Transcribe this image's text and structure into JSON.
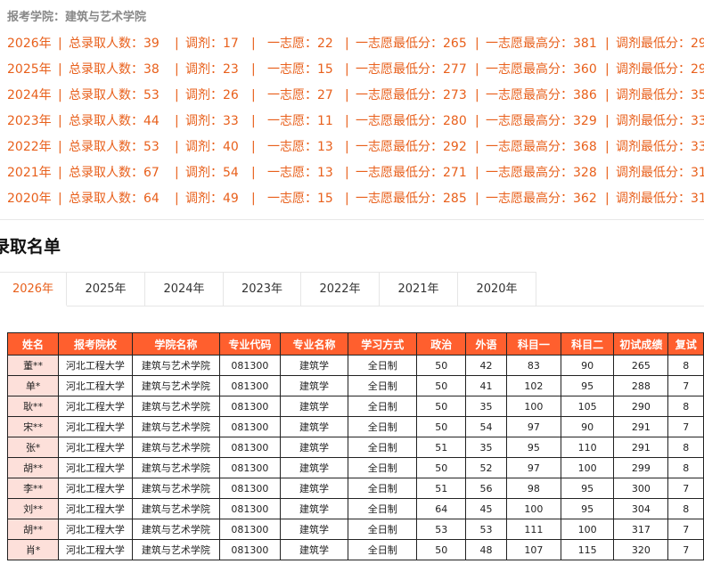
{
  "college_line": "报考学院：建筑与艺术学院",
  "stats": [
    {
      "year": "2026年",
      "total": "总录取人数：39",
      "adjust": "调剂：17",
      "first": "一志愿：22",
      "first_min": "一志愿最低分：265",
      "first_max": "一志愿最高分：381",
      "adjust_min": "调剂最低分：29"
    },
    {
      "year": "2025年",
      "total": "总录取人数：38",
      "adjust": "调剂：23",
      "first": "一志愿：15",
      "first_min": "一志愿最低分：277",
      "first_max": "一志愿最高分：360",
      "adjust_min": "调剂最低分：29"
    },
    {
      "year": "2024年",
      "total": "总录取人数：53",
      "adjust": "调剂：26",
      "first": "一志愿：27",
      "first_min": "一志愿最低分：273",
      "first_max": "一志愿最高分：386",
      "adjust_min": "调剂最低分：35"
    },
    {
      "year": "2023年",
      "total": "总录取人数：44",
      "adjust": "调剂：33",
      "first": "一志愿：11",
      "first_min": "一志愿最低分：280",
      "first_max": "一志愿最高分：329",
      "adjust_min": "调剂最低分：33"
    },
    {
      "year": "2022年",
      "total": "总录取人数：53",
      "adjust": "调剂：40",
      "first": "一志愿：13",
      "first_min": "一志愿最低分：292",
      "first_max": "一志愿最高分：368",
      "adjust_min": "调剂最低分：33"
    },
    {
      "year": "2021年",
      "total": "总录取人数：67",
      "adjust": "调剂：54",
      "first": "一志愿：13",
      "first_min": "一志愿最低分：271",
      "first_max": "一志愿最高分：328",
      "adjust_min": "调剂最低分：31"
    },
    {
      "year": "2020年",
      "total": "总录取人数：64",
      "adjust": "调剂：49",
      "first": "一志愿：15",
      "first_min": "一志愿最低分：285",
      "first_max": "一志愿最高分：362",
      "adjust_min": "调剂最低分：31"
    }
  ],
  "separator": "|",
  "section_title": "录取名单",
  "tabs": [
    {
      "label": "2026年",
      "active": true
    },
    {
      "label": "2025年",
      "active": false
    },
    {
      "label": "2024年",
      "active": false
    },
    {
      "label": "2023年",
      "active": false
    },
    {
      "label": "2022年",
      "active": false
    },
    {
      "label": "2021年",
      "active": false
    },
    {
      "label": "2020年",
      "active": false
    }
  ],
  "table": {
    "headers": [
      "姓名",
      "报考院校",
      "学院名称",
      "专业代码",
      "专业名称",
      "学习方式",
      "政治",
      "外语",
      "科目一",
      "科目二",
      "初试成绩",
      "复试"
    ],
    "rows": [
      [
        "董**",
        "河北工程大学",
        "建筑与艺术学院",
        "081300",
        "建筑学",
        "全日制",
        "50",
        "42",
        "83",
        "90",
        "265",
        "8"
      ],
      [
        "单*",
        "河北工程大学",
        "建筑与艺术学院",
        "081300",
        "建筑学",
        "全日制",
        "50",
        "41",
        "102",
        "95",
        "288",
        "7"
      ],
      [
        "耿**",
        "河北工程大学",
        "建筑与艺术学院",
        "081300",
        "建筑学",
        "全日制",
        "50",
        "35",
        "100",
        "105",
        "290",
        "8"
      ],
      [
        "宋**",
        "河北工程大学",
        "建筑与艺术学院",
        "081300",
        "建筑学",
        "全日制",
        "50",
        "54",
        "97",
        "90",
        "291",
        "7"
      ],
      [
        "张*",
        "河北工程大学",
        "建筑与艺术学院",
        "081300",
        "建筑学",
        "全日制",
        "51",
        "35",
        "95",
        "110",
        "291",
        "8"
      ],
      [
        "胡**",
        "河北工程大学",
        "建筑与艺术学院",
        "081300",
        "建筑学",
        "全日制",
        "50",
        "52",
        "97",
        "100",
        "299",
        "8"
      ],
      [
        "李**",
        "河北工程大学",
        "建筑与艺术学院",
        "081300",
        "建筑学",
        "全日制",
        "51",
        "56",
        "98",
        "95",
        "300",
        "7"
      ],
      [
        "刘**",
        "河北工程大学",
        "建筑与艺术学院",
        "081300",
        "建筑学",
        "全日制",
        "64",
        "45",
        "100",
        "95",
        "304",
        "8"
      ],
      [
        "胡**",
        "河北工程大学",
        "建筑与艺术学院",
        "081300",
        "建筑学",
        "全日制",
        "53",
        "53",
        "111",
        "100",
        "317",
        "7"
      ],
      [
        "肖*",
        "河北工程大学",
        "建筑与艺术学院",
        "081300",
        "建筑学",
        "全日制",
        "50",
        "48",
        "107",
        "115",
        "320",
        "7"
      ]
    ]
  }
}
